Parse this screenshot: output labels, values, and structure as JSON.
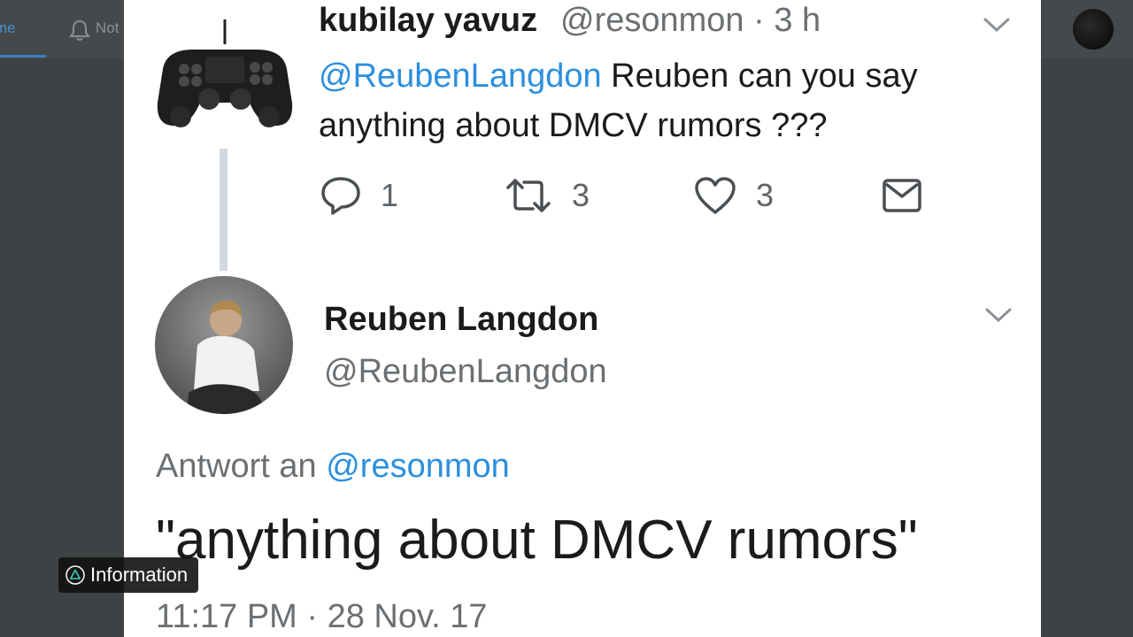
{
  "background": {
    "nav": {
      "home_label": "me",
      "notifications_label": "Not"
    }
  },
  "tweet1": {
    "author_name": "kubilay yavuz",
    "meta": "@resonmon · 3 h",
    "mention": "@ReubenLangdon",
    "text": " Reuben can you say anything about DMCV rumors ???",
    "actions": {
      "reply_count": "1",
      "retweet_count": "3",
      "like_count": "3"
    }
  },
  "tweet2": {
    "author_name": "Reuben Langdon",
    "handle": "@ReubenLangdon",
    "reply_prefix": "Antwort an ",
    "reply_mention": "@resonmon",
    "text": "\"anything about DMCV rumors\"",
    "timestamp": "11:17 PM · 28 Nov. 17"
  },
  "overlay": {
    "info_label": "Information"
  },
  "colors": {
    "mention": "#2c8fde",
    "text": "#1b1b1b",
    "muted": "#6a6f73",
    "icon": "#4a4f53",
    "backdrop": "#3f4244"
  }
}
